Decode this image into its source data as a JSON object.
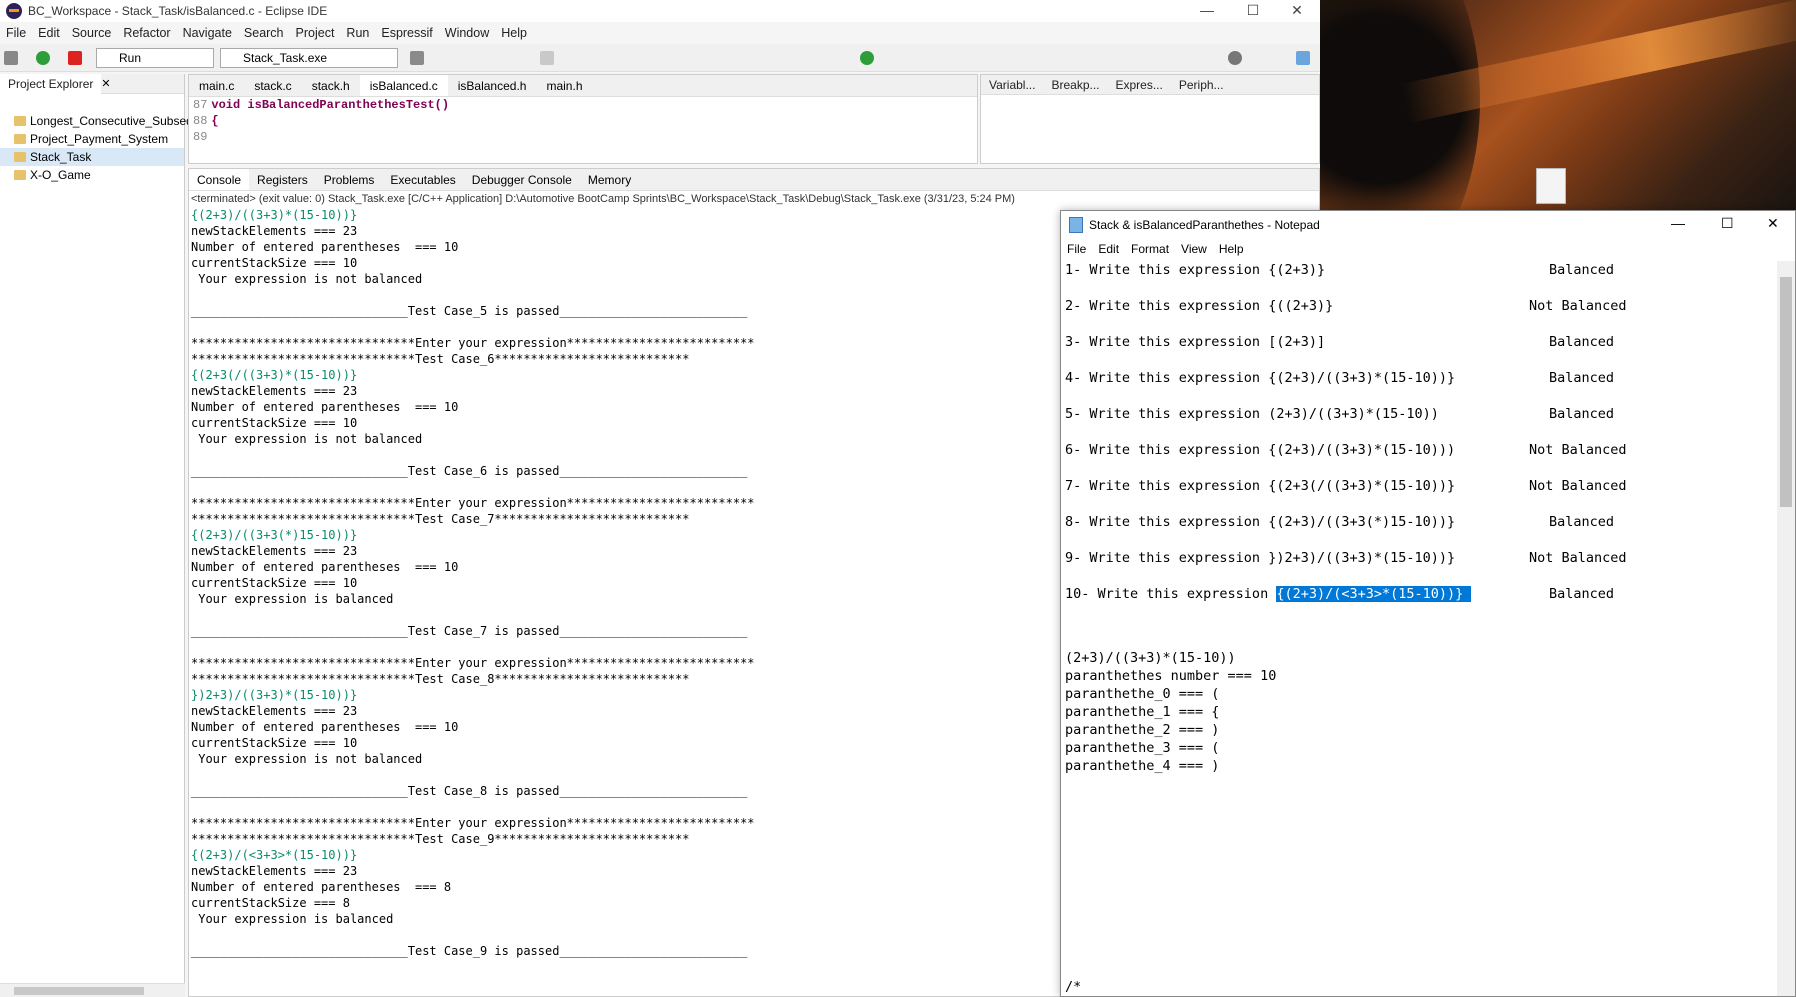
{
  "eclipse": {
    "title": "BC_Workspace - Stack_Task/isBalanced.c - Eclipse IDE",
    "menu": [
      "File",
      "Edit",
      "Source",
      "Refactor",
      "Navigate",
      "Search",
      "Project",
      "Run",
      "Espressif",
      "Window",
      "Help"
    ],
    "run_config": "Run",
    "launch_target": "Stack_Task.exe"
  },
  "project_explorer": {
    "tab": "Project Explorer",
    "items": [
      "Longest_Consecutive_Subseq",
      "Project_Payment_System",
      "Stack_Task",
      "X-O_Game"
    ],
    "selected": "Stack_Task"
  },
  "editor": {
    "tabs": [
      "main.c",
      "stack.c",
      "stack.h",
      "isBalanced.c",
      "isBalanced.h",
      "main.h"
    ],
    "active": "isBalanced.c",
    "lines": [
      {
        "num": "87",
        "code": "void isBalancedParanthethesTest()"
      },
      {
        "num": "88",
        "code": "{"
      },
      {
        "num": "89",
        "code": ""
      }
    ]
  },
  "right_view": {
    "tabs": [
      "Variabl...",
      "Breakp...",
      "Expres...",
      "Periph..."
    ]
  },
  "console": {
    "tabs": [
      "Console",
      "Registers",
      "Problems",
      "Executables",
      "Debugger Console",
      "Memory"
    ],
    "header": "<terminated> (exit value: 0) Stack_Task.exe [C/C++ Application] D:\\Automotive BootCamp Sprints\\BC_Workspace\\Stack_Task\\Debug\\Stack_Task.exe (3/31/23, 5:24 PM)",
    "lines": [
      {
        "t": "{(2+3)/((3+3)*(15-10))}",
        "in": true
      },
      {
        "t": "newStackElements === 23"
      },
      {
        "t": "Number of entered parentheses  === 10"
      },
      {
        "t": "currentStackSize === 10"
      },
      {
        "t": " Your expression is not balanced"
      },
      {
        "t": ""
      },
      {
        "t": "______________________________Test Case_5 is passed__________________________"
      },
      {
        "t": ""
      },
      {
        "t": "*******************************Enter your expression**************************"
      },
      {
        "t": "*******************************Test Case_6***************************"
      },
      {
        "t": "{(2+3(/((3+3)*(15-10))}",
        "in": true
      },
      {
        "t": "newStackElements === 23"
      },
      {
        "t": "Number of entered parentheses  === 10"
      },
      {
        "t": "currentStackSize === 10"
      },
      {
        "t": " Your expression is not balanced"
      },
      {
        "t": ""
      },
      {
        "t": "______________________________Test Case_6 is passed__________________________"
      },
      {
        "t": ""
      },
      {
        "t": "*******************************Enter your expression**************************"
      },
      {
        "t": "*******************************Test Case_7***************************"
      },
      {
        "t": "{(2+3)/((3+3(*)15-10))}",
        "in": true
      },
      {
        "t": "newStackElements === 23"
      },
      {
        "t": "Number of entered parentheses  === 10"
      },
      {
        "t": "currentStackSize === 10"
      },
      {
        "t": " Your expression is balanced"
      },
      {
        "t": ""
      },
      {
        "t": "______________________________Test Case_7 is passed__________________________"
      },
      {
        "t": ""
      },
      {
        "t": "*******************************Enter your expression**************************"
      },
      {
        "t": "*******************************Test Case_8***************************"
      },
      {
        "t": "})2+3)/((3+3)*(15-10))}",
        "in": true
      },
      {
        "t": "newStackElements === 23"
      },
      {
        "t": "Number of entered parentheses  === 10"
      },
      {
        "t": "currentStackSize === 10"
      },
      {
        "t": " Your expression is not balanced"
      },
      {
        "t": ""
      },
      {
        "t": "______________________________Test Case_8 is passed__________________________"
      },
      {
        "t": ""
      },
      {
        "t": "*******************************Enter your expression**************************"
      },
      {
        "t": "*******************************Test Case_9***************************"
      },
      {
        "t": "{(2+3)/(<3+3>*(15-10))}",
        "in": true
      },
      {
        "t": "newStackElements === 23"
      },
      {
        "t": "Number of entered parentheses  === 8"
      },
      {
        "t": "currentStackSize === 8"
      },
      {
        "t": " Your expression is balanced"
      },
      {
        "t": ""
      },
      {
        "t": "______________________________Test Case_9 is passed__________________________"
      }
    ]
  },
  "notepad": {
    "title": "Stack & isBalancedParanthethes - Notepad",
    "menu": [
      "File",
      "Edit",
      "Format",
      "View",
      "Help"
    ],
    "rows": [
      {
        "pre": "1- Write this expression {(2+3)}",
        "res": "Balanced"
      },
      {
        "pre": "2- Write this expression {((2+3)}",
        "res": "Not Balanced"
      },
      {
        "pre": "3- Write this expression [(2+3)]",
        "res": "Balanced"
      },
      {
        "pre": "4- Write this expression {(2+3)/((3+3)*(15-10))}",
        "res": "Balanced"
      },
      {
        "pre": "5- Write this expression (2+3)/((3+3)*(15-10))",
        "res": "Balanced"
      },
      {
        "pre": "6- Write this expression {(2+3)/((3+3)*(15-10)))",
        "res": "Not Balanced"
      },
      {
        "pre": "7- Write this expression {(2+3(/((3+3)*(15-10))}",
        "res": "Not Balanced"
      },
      {
        "pre": "8- Write this expression {(2+3)/((3+3(*)15-10))}",
        "res": "Balanced"
      },
      {
        "pre": "9- Write this expression })2+3)/((3+3)*(15-10))}",
        "res": "Not Balanced"
      },
      {
        "pre": "10- Write this expression ",
        "sel": "{(2+3)/(<3+3>*(15-10))} ",
        "res": "Balanced"
      }
    ],
    "tail": [
      "(2+3)/((3+3)*(15-10))",
      "paranthethes number === 10",
      "paranthethe_0 === (",
      "paranthethe_1 === {",
      "paranthethe_2 === )",
      "paranthethe_3 === (",
      "paranthethe_4 === )"
    ],
    "bottom": "/*"
  }
}
